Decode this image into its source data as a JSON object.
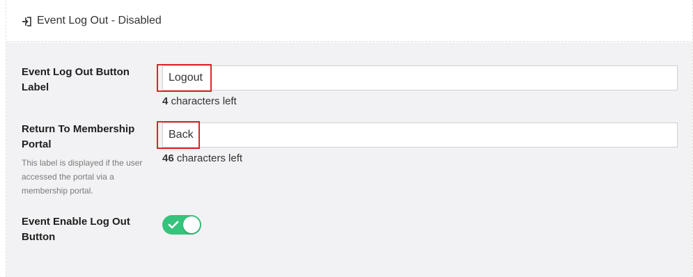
{
  "header": {
    "icon": "sign-in-icon",
    "title": "Event Log Out - Disabled"
  },
  "fields": {
    "logout_label": {
      "label": "Event Log Out Button Label",
      "value": "Logout",
      "chars_left": "4",
      "chars_left_suffix": " characters left"
    },
    "return_label": {
      "label": "Return To Membership Portal",
      "help": "This label is displayed if the user accessed the portal via a membership portal.",
      "value": "Back",
      "chars_left": "46",
      "chars_left_suffix": " characters left"
    },
    "enable_logout": {
      "label": "Event Enable Log Out Button",
      "enabled": true,
      "on_color": "#35c47c"
    }
  },
  "colors": {
    "highlight": "#e02424",
    "panel_bg": "#f2f2f4"
  }
}
